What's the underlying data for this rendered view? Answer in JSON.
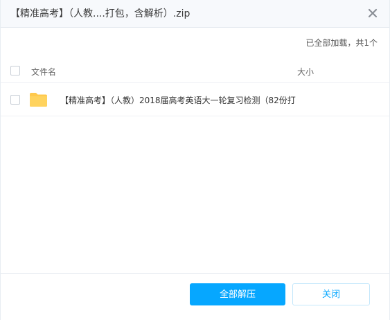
{
  "dialog": {
    "title": "【精准高考】（人教....打包，含解析）.zip",
    "close_icon": "close-icon"
  },
  "status": {
    "text": "已全部加载，共1个"
  },
  "table": {
    "columns": {
      "name": "文件名",
      "size": "大小"
    },
    "rows": [
      {
        "icon": "folder-icon",
        "name": "【精准高考】（人教）2018届高考英语大一轮复习检测（82份打",
        "size": ""
      }
    ]
  },
  "footer": {
    "extract_all_label": "全部解压",
    "close_label": "关闭"
  },
  "colors": {
    "accent": "#06a7ff",
    "folder": "#ffc94d",
    "title_bg": "#f7f9fc"
  }
}
